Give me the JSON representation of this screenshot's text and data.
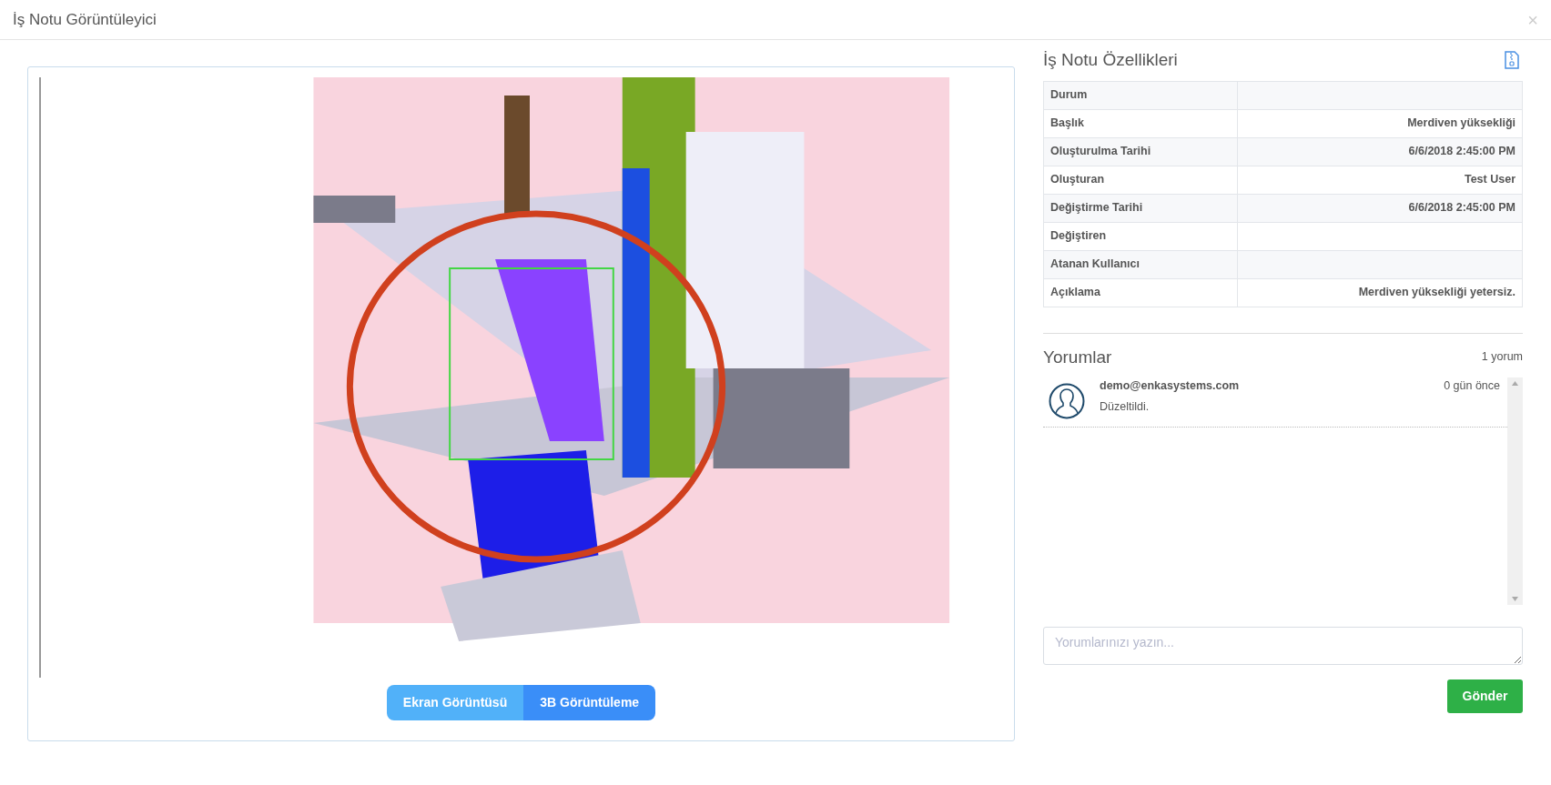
{
  "window": {
    "title": "İş Notu Görüntüleyici",
    "close": "×"
  },
  "viewer": {
    "buttons": [
      {
        "label": "Ekran Görüntüsü",
        "selected": false
      },
      {
        "label": "3B Görüntüleme",
        "selected": true
      }
    ]
  },
  "properties": {
    "title": "İş Notu Özellikleri",
    "rows": [
      {
        "label": "Durum",
        "value": ""
      },
      {
        "label": "Başlık",
        "value": "Merdiven yüksekliği"
      },
      {
        "label": "Oluşturulma Tarihi",
        "value": "6/6/2018 2:45:00 PM"
      },
      {
        "label": "Oluşturan",
        "value": "Test User"
      },
      {
        "label": "Değiştirme Tarihi",
        "value": "6/6/2018 2:45:00 PM"
      },
      {
        "label": "Değiştiren",
        "value": ""
      },
      {
        "label": "Atanan Kullanıcı",
        "value": ""
      },
      {
        "label": "Açıklama",
        "value": "Merdiven yüksekliği yetersiz."
      }
    ]
  },
  "comments": {
    "title": "Yorumlar",
    "count": "1 yorum",
    "items": [
      {
        "author": "demo@enkasystems.com",
        "text": "Düzeltildi.",
        "time": "0 gün önce"
      }
    ],
    "input": {
      "placeholder": "Yorumlarınızı yazın..."
    },
    "send": "Gönder"
  }
}
